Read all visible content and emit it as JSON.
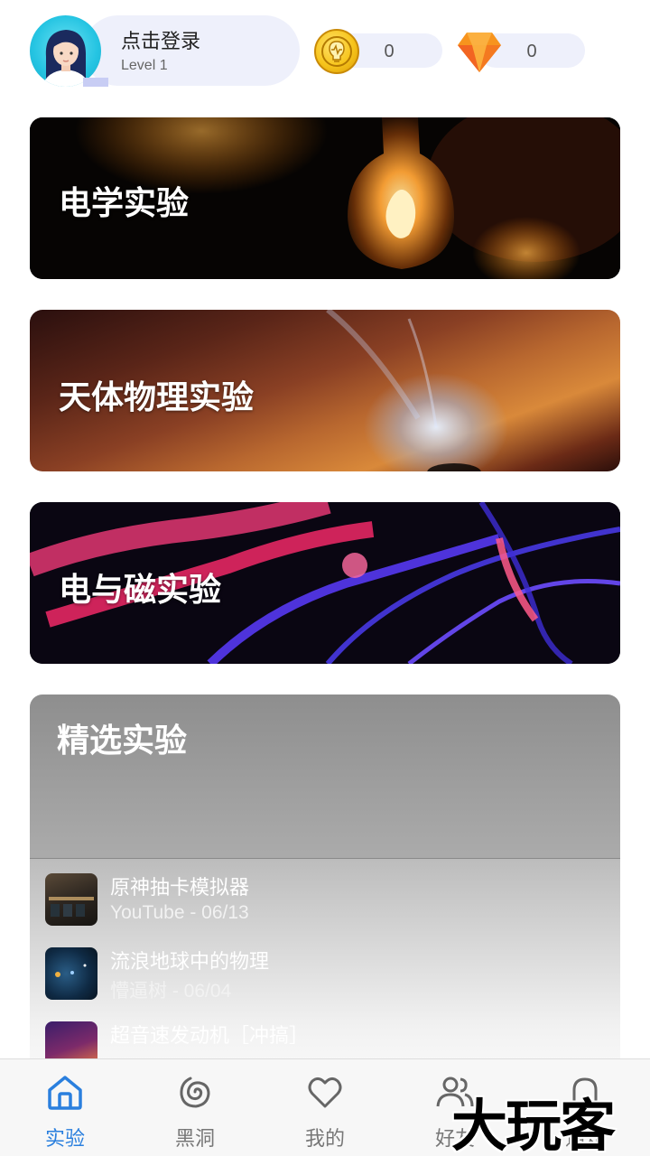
{
  "header": {
    "login_title": "点击登录",
    "level": "Level 1",
    "coins": "0",
    "gems": "0"
  },
  "categories": [
    {
      "label": "电学实验"
    },
    {
      "label": "天体物理实验"
    },
    {
      "label": "电与磁实验"
    }
  ],
  "featured": {
    "title": "精选实验",
    "items": [
      {
        "title": "原神抽卡模拟器",
        "meta": "YouTube - 06/13"
      },
      {
        "title": "流浪地球中的物理",
        "meta": "懵逼树 - 06/04"
      },
      {
        "title": "超音速发动机［冲搞］",
        "meta": ""
      }
    ]
  },
  "tabs": [
    {
      "label": "实验",
      "icon": "home-icon",
      "active": true
    },
    {
      "label": "黑洞",
      "icon": "spiral-icon",
      "active": false
    },
    {
      "label": "我的",
      "icon": "heart-icon",
      "active": false
    },
    {
      "label": "好友",
      "icon": "friends-icon",
      "active": false
    },
    {
      "label": "通知",
      "icon": "bell-icon",
      "active": false
    }
  ],
  "watermark": "大玩客",
  "colors": {
    "accent": "#2a7fde",
    "pill": "#eef0fb"
  }
}
